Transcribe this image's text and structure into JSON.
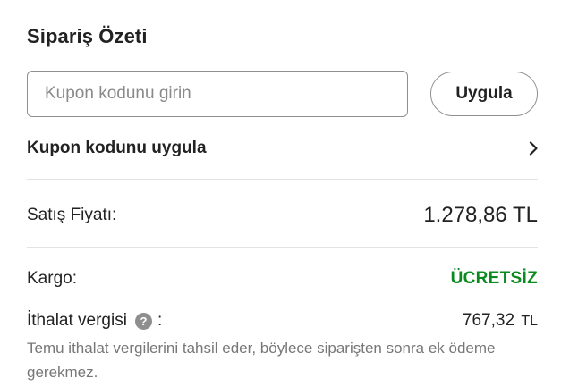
{
  "order_summary": {
    "title": "Sipariş Özeti",
    "coupon": {
      "placeholder": "Kupon kodunu girin",
      "value": "",
      "apply_button_label": "Uygula",
      "apply_link_label": "Kupon kodunu uygula",
      "apply_link_icon": "chevron-right-icon"
    },
    "sale_price": {
      "label": "Satış Fiyatı:",
      "value": "1.278,86 TL"
    },
    "shipping": {
      "label": "Kargo:",
      "value": "ÜCRETSİZ",
      "color": "#0a8a1f"
    },
    "import_duty": {
      "label": "İthalat vergisi",
      "help_icon": "question-mark-icon",
      "help_glyph": "?",
      "colon": ":",
      "amount": "767,32",
      "currency": "TL",
      "note": "Temu ithalat vergilerini tahsil eder, böylece siparişten sonra ek ödeme gerekmez."
    }
  }
}
